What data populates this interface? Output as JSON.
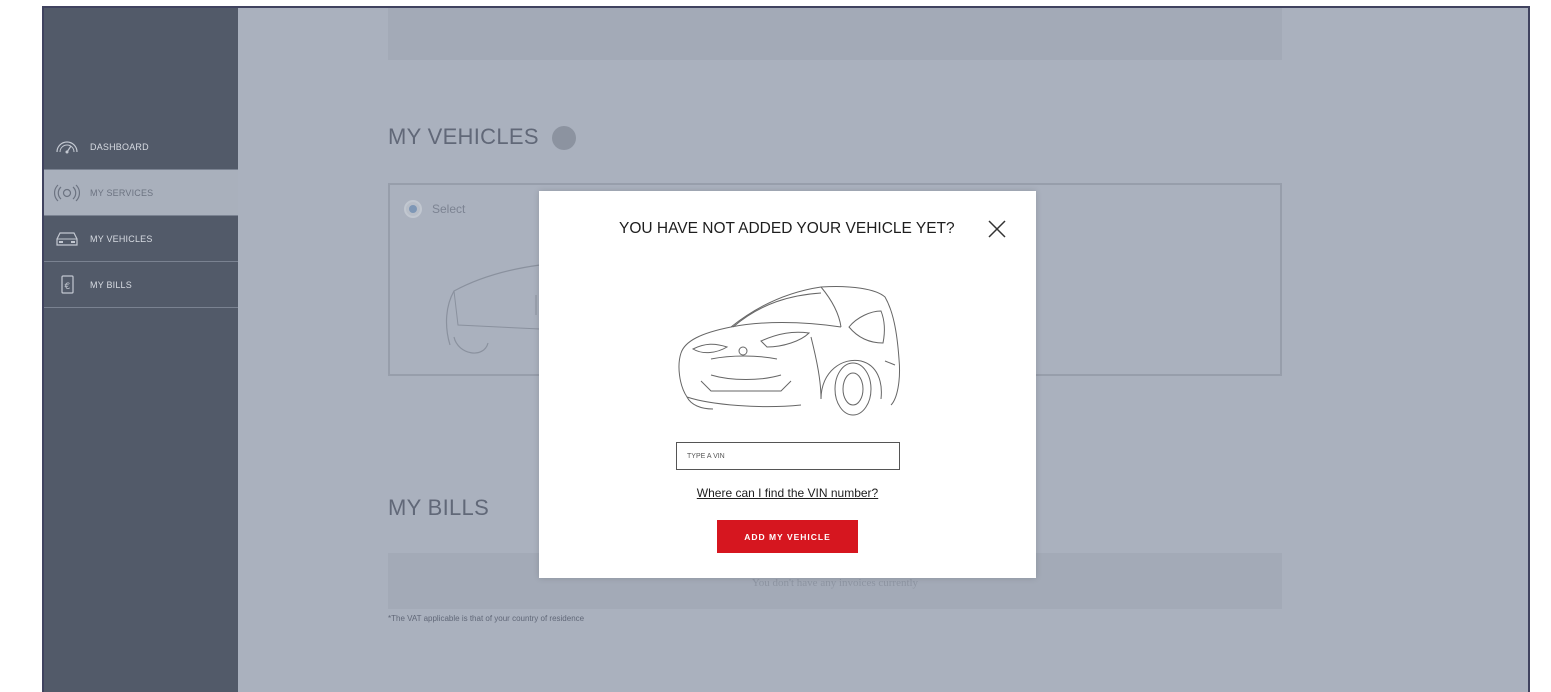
{
  "sidebar": {
    "items": [
      {
        "label": "DASHBOARD",
        "icon": "dashboard-icon"
      },
      {
        "label": "MY SERVICES",
        "icon": "connected-services-icon",
        "active": true
      },
      {
        "label": "MY VEHICLES",
        "icon": "car-front-icon"
      },
      {
        "label": "MY BILLS",
        "icon": "invoice-euro-icon"
      }
    ]
  },
  "main": {
    "vehicles_title": "MY VEHICLES",
    "select_label": "Select",
    "bills_title": "MY BILLS",
    "bills_empty": "You don't have any invoices currently",
    "vat_note": "*The VAT applicable is that of your country of residence"
  },
  "modal": {
    "title": "YOU HAVE NOT ADDED YOUR VEHICLE YET?",
    "vin_placeholder": "TYPE A VIN",
    "vin_value": "",
    "vin_help_link": "Where can I find the VIN number?",
    "add_button": "ADD MY VEHICLE",
    "close_icon": "close-icon"
  },
  "colors": {
    "accent": "#d6161f",
    "overlay": "#aab1be",
    "sidebar": "#525a69",
    "frame_border": "#40435f"
  }
}
